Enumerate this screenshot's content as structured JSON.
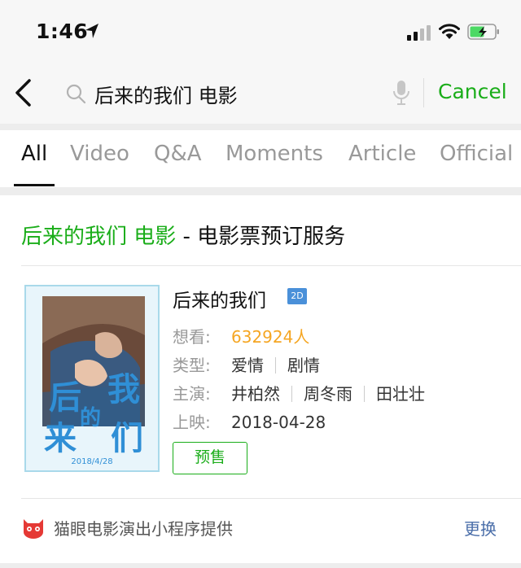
{
  "status_bar": {
    "time": "1:46"
  },
  "search": {
    "query": "后来的我们 电影",
    "cancel_label": "Cancel"
  },
  "tabs": [
    {
      "label": "All",
      "active": true
    },
    {
      "label": "Video"
    },
    {
      "label": "Q&A"
    },
    {
      "label": "Moments"
    },
    {
      "label": "Article"
    },
    {
      "label": "Official"
    }
  ],
  "result": {
    "title_highlight": "后来的我们 电影",
    "title_rest": " - 电影票预订服务",
    "movie": {
      "name": "后来的我们",
      "format_badge": "2D",
      "want_label": "想看:",
      "want_value": "632924人",
      "genre_label": "类型:",
      "genres": [
        "爱情",
        "剧情"
      ],
      "cast_label": "主演:",
      "cast": [
        "井柏然",
        "周冬雨",
        "田壮壮"
      ],
      "release_label": "上映:",
      "release_date": "2018-04-28",
      "preview_button": "预售",
      "poster_date": "2018/4/28"
    },
    "provider_text": "猫眼电影演出小程序提供",
    "change_label": "更换"
  },
  "colors": {
    "accent": "#1aad19",
    "orange": "#f5a623",
    "link": "#4a6ea9"
  }
}
